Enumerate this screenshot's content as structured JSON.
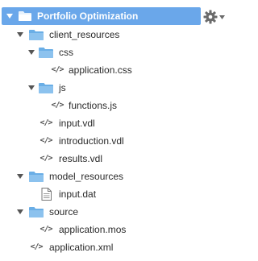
{
  "tree": {
    "root": {
      "label": "Portfolio Optimization",
      "icon": "folder-open-icon",
      "expanded": true,
      "selected": true,
      "accent_color": "#6aa7ea"
    },
    "settings": {
      "icon": "gear-icon",
      "menu_icon": "caret-down-icon"
    },
    "nodes": [
      {
        "label": "client_resources",
        "type": "folder",
        "expanded": true
      },
      {
        "label": "css",
        "type": "folder",
        "expanded": true
      },
      {
        "label": "application.css",
        "type": "code-file"
      },
      {
        "label": "js",
        "type": "folder",
        "expanded": true
      },
      {
        "label": "functions.js",
        "type": "code-file"
      },
      {
        "label": "input.vdl",
        "type": "code-file"
      },
      {
        "label": "introduction.vdl",
        "type": "code-file"
      },
      {
        "label": "results.vdl",
        "type": "code-file"
      },
      {
        "label": "model_resources",
        "type": "folder",
        "expanded": true
      },
      {
        "label": "input.dat",
        "type": "document-file"
      },
      {
        "label": "source",
        "type": "folder",
        "expanded": true
      },
      {
        "label": "application.mos",
        "type": "code-file"
      },
      {
        "label": "application.xml",
        "type": "code-file"
      }
    ]
  },
  "colors": {
    "folder": "#8cc2ee",
    "folder_dark": "#6aaee6",
    "selection": "#6aa7ea",
    "toggle": "#555555",
    "gear": "#6b6b6b"
  }
}
